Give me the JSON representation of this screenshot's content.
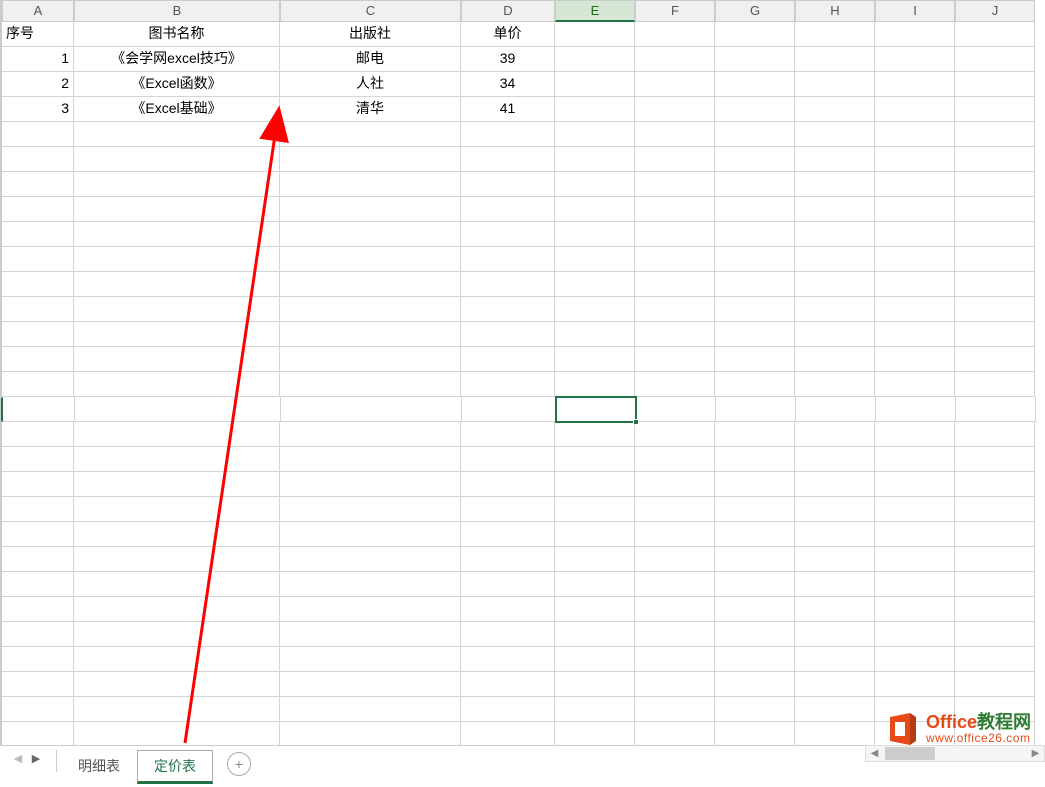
{
  "columns": [
    "A",
    "B",
    "C",
    "D",
    "E",
    "F",
    "G",
    "H",
    "I",
    "J"
  ],
  "selected_column": "E",
  "selected_row": 16,
  "headers": {
    "A": "序号",
    "B": "图书名称",
    "C": "出版社",
    "D": "单价"
  },
  "rows": [
    {
      "A": "1",
      "B": "《会学网excel技巧》",
      "C": "邮电",
      "D": "39"
    },
    {
      "A": "2",
      "B": "《Excel函数》",
      "C": "人社",
      "D": "34"
    },
    {
      "A": "3",
      "B": "《Excel基础》",
      "C": "清华",
      "D": "41"
    }
  ],
  "blank_rows": 25,
  "tabs": {
    "items": [
      "明细表",
      "定价表"
    ],
    "active": "定价表"
  },
  "add_sheet_symbol": "+",
  "watermark": {
    "title_part1": "Office",
    "title_part2": "教程网",
    "url": "www.office26.com"
  }
}
